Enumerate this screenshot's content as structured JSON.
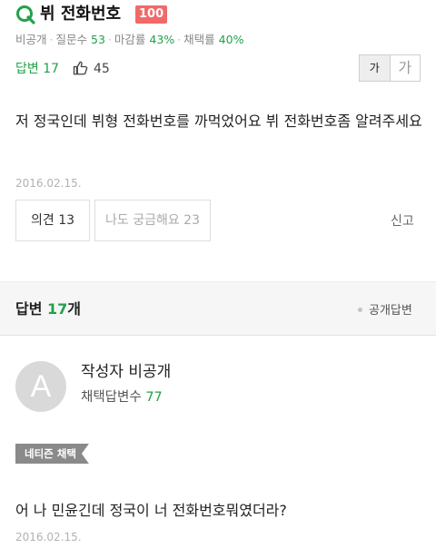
{
  "question": {
    "title": "뷔 전화번호",
    "badge": "100",
    "meta": {
      "visibility": "비공개",
      "questions_label": "질문수",
      "questions_value": "53",
      "close_rate_label": "마감률",
      "close_rate_value": "43%",
      "adopt_rate_label": "채택률",
      "adopt_rate_value": "40%"
    },
    "answers_label": "답변 17",
    "likes": "45",
    "font_small": "가",
    "font_large": "가",
    "body": "저 정국인데 뷔형 전화번호를 까먹었어요 뷔 전화번호좀 알려주세요",
    "date": "2016.02.15.",
    "opinion_button": "의견 13",
    "curious_button": "나도 궁금해요 23",
    "report_button": "신고"
  },
  "answers_section": {
    "label": "답변",
    "count": "17",
    "suffix": "개",
    "public_answer_label": "공개답변"
  },
  "answer": {
    "avatar_letter": "A",
    "author": "작성자 비공개",
    "selected_count_label": "채택답변수",
    "selected_count_value": "77",
    "chosen_badge": "네티즌 채택",
    "body": "어 나 민윤긴데 정국이 너 전화번호뭐였더라?",
    "date": "2016.02.15."
  },
  "colors": {
    "accent_green": "#22a14a",
    "badge_red": "#f16a6a"
  },
  "icons": [
    "question-q-icon",
    "thumbs-up-icon"
  ]
}
